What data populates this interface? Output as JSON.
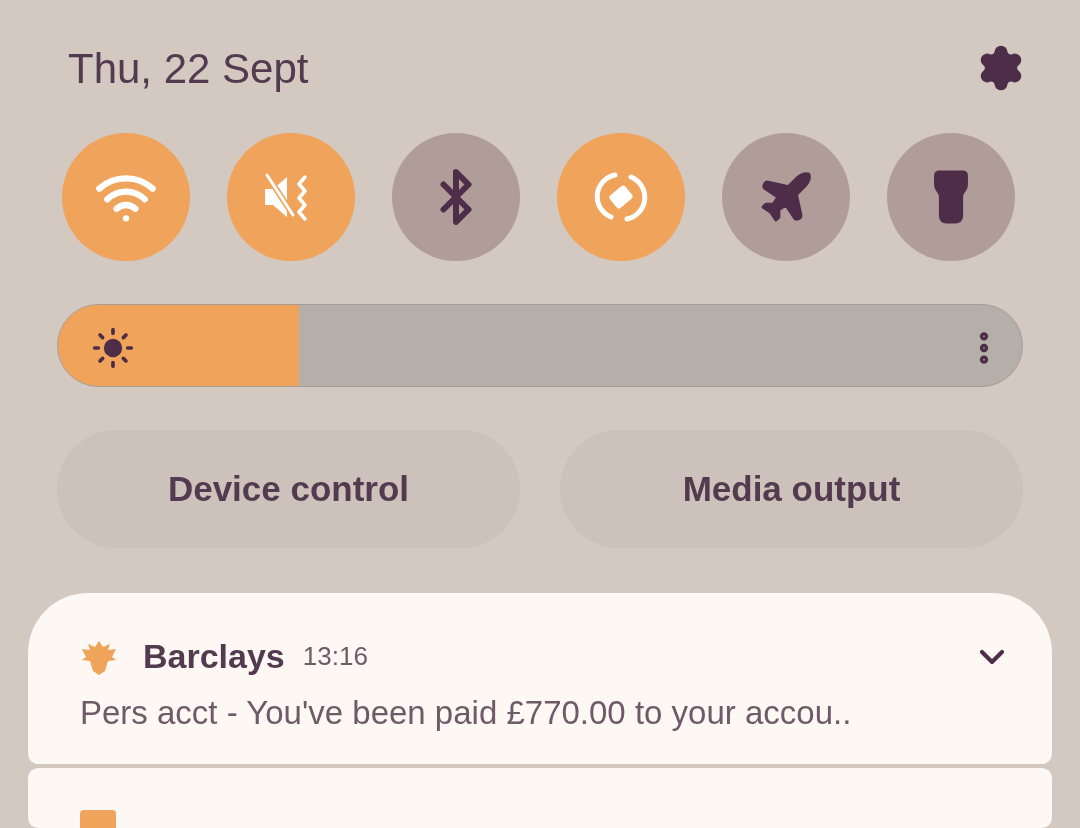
{
  "date": "Thu, 22 Sept",
  "toggles": [
    {
      "kind": "wifi",
      "on": true
    },
    {
      "kind": "sound",
      "on": true
    },
    {
      "kind": "bluetooth",
      "on": false
    },
    {
      "kind": "rotate",
      "on": true
    },
    {
      "kind": "airplane",
      "on": false
    },
    {
      "kind": "flashlight",
      "on": false
    }
  ],
  "brightness": {
    "level": 0.25
  },
  "buttons": [
    "Device control",
    "Media output"
  ],
  "notifications": [
    {
      "app": "Barclays",
      "time": "13:16",
      "text": "Pers acct - You've been paid £770.00 to your accou.."
    }
  ]
}
